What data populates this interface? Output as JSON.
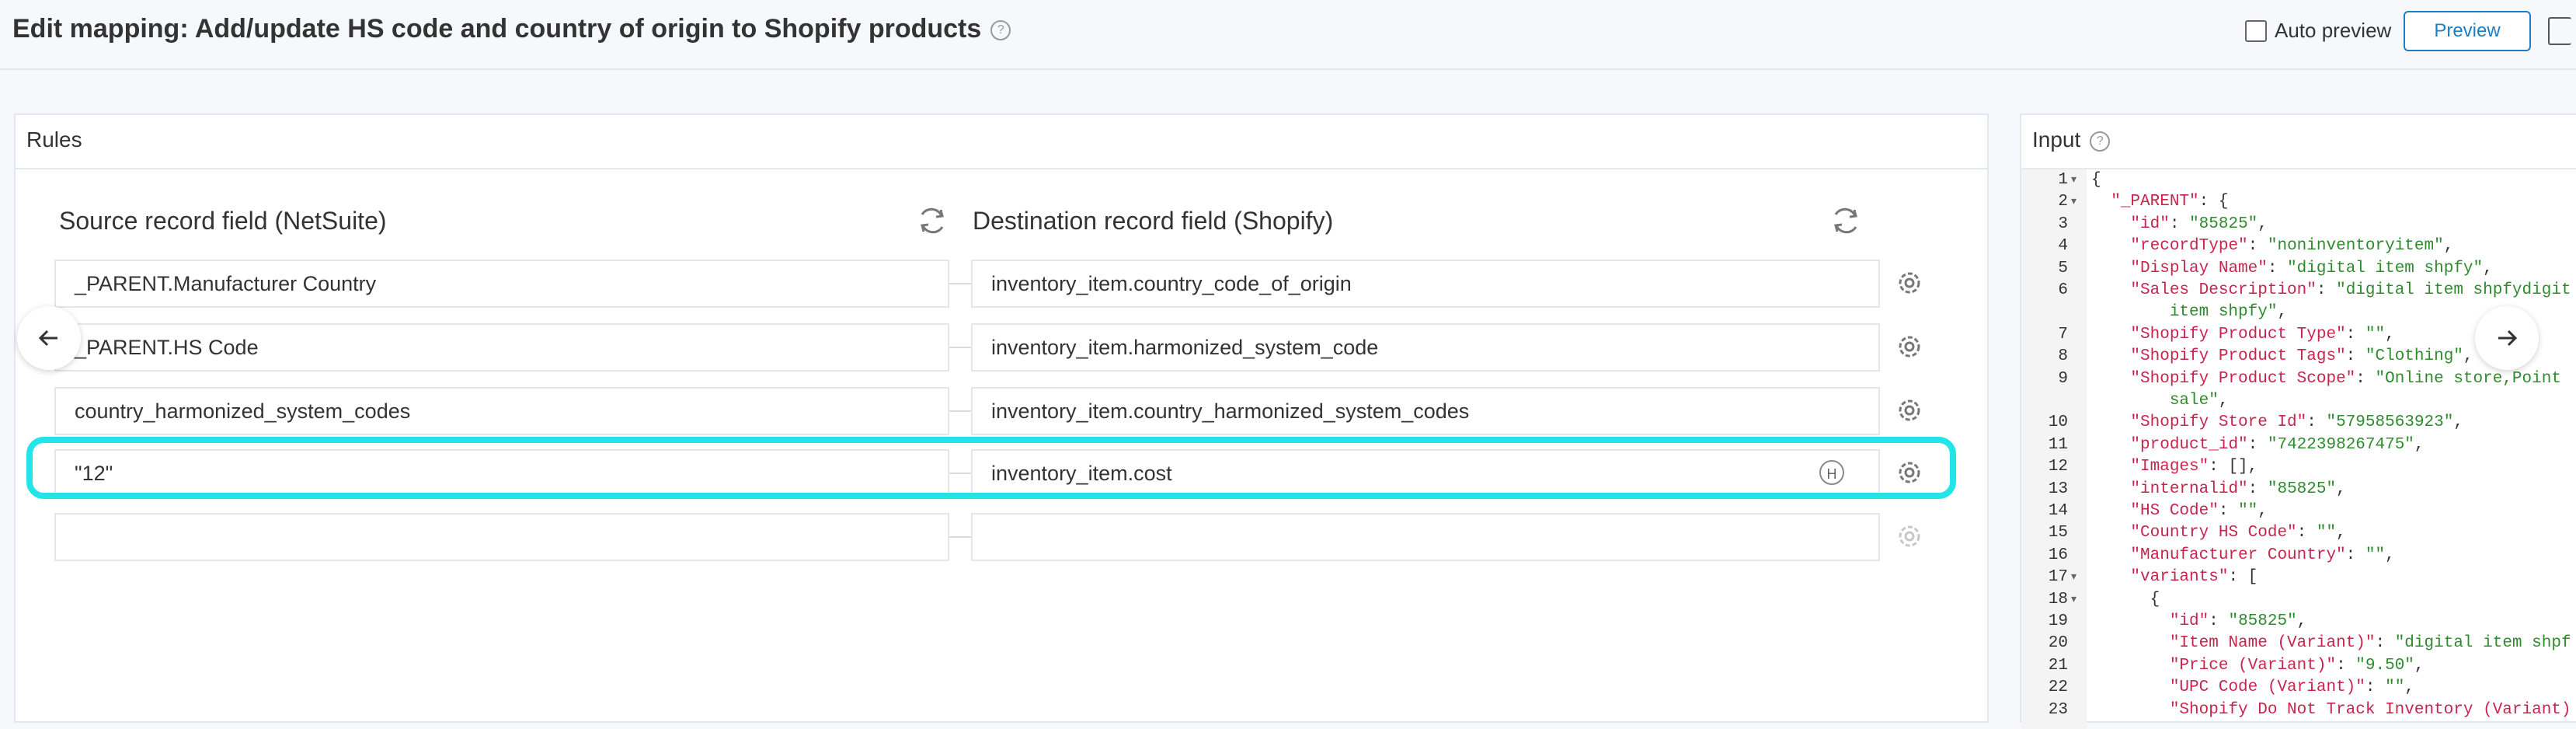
{
  "header": {
    "title": "Edit mapping: Add/update HS code and country of origin to Shopify products",
    "help": "?",
    "auto_preview_label": "Auto preview",
    "preview_label": "Preview"
  },
  "rules": {
    "title": "Rules",
    "source_header": "Source record field (NetSuite)",
    "destination_header": "Destination record field (Shopify)",
    "rows": [
      {
        "source": "_PARENT.Manufacturer Country",
        "destination": "inventory_item.country_code_of_origin"
      },
      {
        "source": "_PARENT.HS Code",
        "destination": "inventory_item.harmonized_system_code"
      },
      {
        "source": "country_harmonized_system_codes",
        "destination": "inventory_item.country_harmonized_system_codes"
      },
      {
        "source": "\"12\"",
        "destination": "inventory_item.cost",
        "badge": "H"
      },
      {
        "source": "",
        "destination": ""
      }
    ]
  },
  "input": {
    "title": "Input",
    "help": "?",
    "lines": [
      {
        "n": "1",
        "fold": true,
        "text": [
          [
            "p",
            "{"
          ]
        ]
      },
      {
        "n": "2",
        "fold": true,
        "text": [
          [
            "p",
            "  "
          ],
          [
            "k",
            "\"_PARENT\""
          ],
          [
            "p",
            ": {"
          ]
        ]
      },
      {
        "n": "3",
        "text": [
          [
            "p",
            "    "
          ],
          [
            "k",
            "\"id\""
          ],
          [
            "p",
            ": "
          ],
          [
            "s",
            "\"85825\""
          ],
          [
            "p",
            ","
          ]
        ]
      },
      {
        "n": "4",
        "text": [
          [
            "p",
            "    "
          ],
          [
            "k",
            "\"recordType\""
          ],
          [
            "p",
            ": "
          ],
          [
            "s",
            "\"noninventoryitem\""
          ],
          [
            "p",
            ","
          ]
        ]
      },
      {
        "n": "5",
        "text": [
          [
            "p",
            "    "
          ],
          [
            "k",
            "\"Display Name\""
          ],
          [
            "p",
            ": "
          ],
          [
            "s",
            "\"digital item shpfy\""
          ],
          [
            "p",
            ","
          ]
        ]
      },
      {
        "n": "6",
        "text": [
          [
            "p",
            "    "
          ],
          [
            "k",
            "\"Sales Description\""
          ],
          [
            "p",
            ": "
          ],
          [
            "s",
            "\"digital item shpfydigit"
          ]
        ]
      },
      {
        "n": "",
        "text": [
          [
            "s",
            "        item shpfy\""
          ],
          [
            "p",
            ","
          ]
        ]
      },
      {
        "n": "7",
        "text": [
          [
            "p",
            "    "
          ],
          [
            "k",
            "\"Shopify Product Type\""
          ],
          [
            "p",
            ": "
          ],
          [
            "s",
            "\"\""
          ],
          [
            "p",
            ","
          ]
        ]
      },
      {
        "n": "8",
        "text": [
          [
            "p",
            "    "
          ],
          [
            "k",
            "\"Shopify Product Tags\""
          ],
          [
            "p",
            ": "
          ],
          [
            "s",
            "\"Clothing\""
          ],
          [
            "p",
            ","
          ]
        ]
      },
      {
        "n": "9",
        "text": [
          [
            "p",
            "    "
          ],
          [
            "k",
            "\"Shopify Product Scope\""
          ],
          [
            "p",
            ": "
          ],
          [
            "s",
            "\"Online store,Point"
          ]
        ]
      },
      {
        "n": "",
        "text": [
          [
            "s",
            "        sale\""
          ],
          [
            "p",
            ","
          ]
        ]
      },
      {
        "n": "10",
        "text": [
          [
            "p",
            "    "
          ],
          [
            "k",
            "\"Shopify Store Id\""
          ],
          [
            "p",
            ": "
          ],
          [
            "s",
            "\"57958563923\""
          ],
          [
            "p",
            ","
          ]
        ]
      },
      {
        "n": "11",
        "text": [
          [
            "p",
            "    "
          ],
          [
            "k",
            "\"product_id\""
          ],
          [
            "p",
            ": "
          ],
          [
            "s",
            "\"7422398267475\""
          ],
          [
            "p",
            ","
          ]
        ]
      },
      {
        "n": "12",
        "text": [
          [
            "p",
            "    "
          ],
          [
            "k",
            "\"Images\""
          ],
          [
            "p",
            ": [],"
          ]
        ]
      },
      {
        "n": "13",
        "text": [
          [
            "p",
            "    "
          ],
          [
            "k",
            "\"internalid\""
          ],
          [
            "p",
            ": "
          ],
          [
            "s",
            "\"85825\""
          ],
          [
            "p",
            ","
          ]
        ]
      },
      {
        "n": "14",
        "text": [
          [
            "p",
            "    "
          ],
          [
            "k",
            "\"HS Code\""
          ],
          [
            "p",
            ": "
          ],
          [
            "s",
            "\"\""
          ],
          [
            "p",
            ","
          ]
        ]
      },
      {
        "n": "15",
        "text": [
          [
            "p",
            "    "
          ],
          [
            "k",
            "\"Country HS Code\""
          ],
          [
            "p",
            ": "
          ],
          [
            "s",
            "\"\""
          ],
          [
            "p",
            ","
          ]
        ]
      },
      {
        "n": "16",
        "text": [
          [
            "p",
            "    "
          ],
          [
            "k",
            "\"Manufacturer Country\""
          ],
          [
            "p",
            ": "
          ],
          [
            "s",
            "\"\""
          ],
          [
            "p",
            ","
          ]
        ]
      },
      {
        "n": "17",
        "fold": true,
        "text": [
          [
            "p",
            "    "
          ],
          [
            "k",
            "\"variants\""
          ],
          [
            "p",
            ": ["
          ]
        ]
      },
      {
        "n": "18",
        "fold": true,
        "text": [
          [
            "p",
            "      {"
          ]
        ]
      },
      {
        "n": "19",
        "text": [
          [
            "p",
            "        "
          ],
          [
            "k",
            "\"id\""
          ],
          [
            "p",
            ": "
          ],
          [
            "s",
            "\"85825\""
          ],
          [
            "p",
            ","
          ]
        ]
      },
      {
        "n": "20",
        "text": [
          [
            "p",
            "        "
          ],
          [
            "k",
            "\"Item Name (Variant)\""
          ],
          [
            "p",
            ": "
          ],
          [
            "s",
            "\"digital item shpf"
          ]
        ]
      },
      {
        "n": "21",
        "text": [
          [
            "p",
            "        "
          ],
          [
            "k",
            "\"Price (Variant)\""
          ],
          [
            "p",
            ": "
          ],
          [
            "s",
            "\"9.50\""
          ],
          [
            "p",
            ","
          ]
        ]
      },
      {
        "n": "22",
        "text": [
          [
            "p",
            "        "
          ],
          [
            "k",
            "\"UPC Code (Variant)\""
          ],
          [
            "p",
            ": "
          ],
          [
            "s",
            "\"\""
          ],
          [
            "p",
            ","
          ]
        ]
      },
      {
        "n": "23",
        "text": [
          [
            "p",
            "        "
          ],
          [
            "k",
            "\"Shopify Do Not Track Inventory (Variant)"
          ]
        ]
      }
    ]
  }
}
